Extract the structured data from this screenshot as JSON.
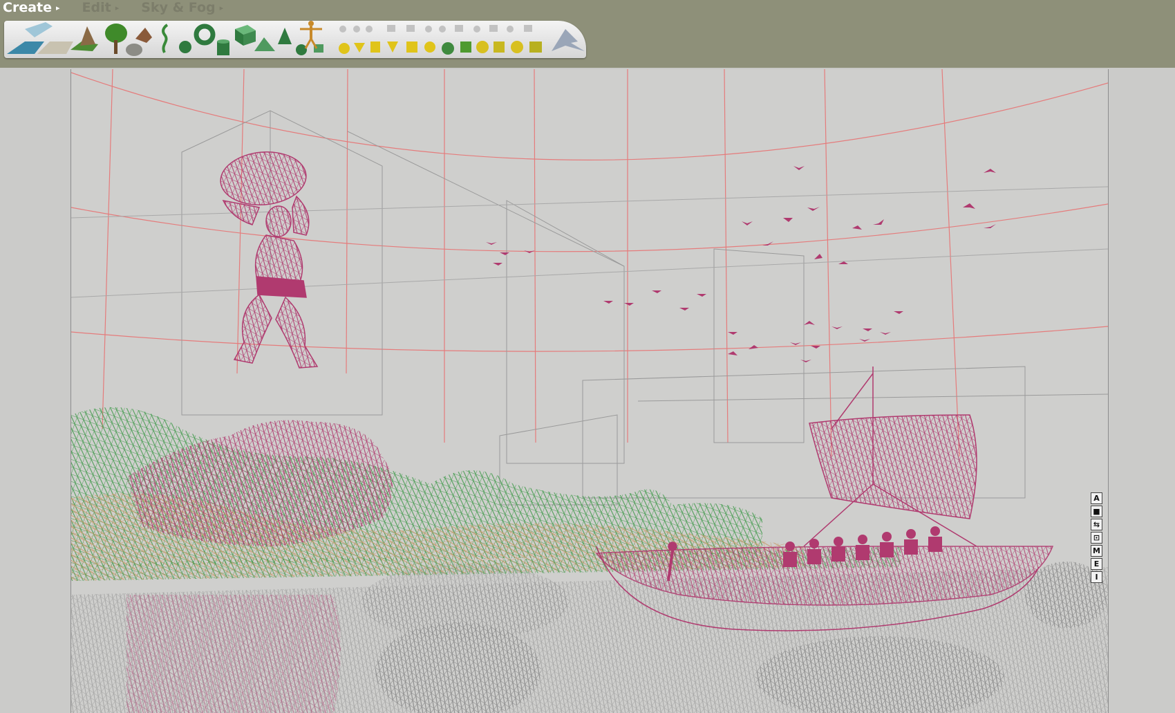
{
  "menu": {
    "create": "Create",
    "edit": "Edit",
    "sky_fog": "Sky & Fog"
  },
  "toolbar_icons": [
    "water-plane-icon",
    "ground-plane-icon",
    "terrain-icon",
    "tree-icon",
    "rock-icon",
    "plant-icon",
    "torus-icon",
    "cube-icon",
    "cone-icon",
    "sphere-icon",
    "cylinder-icon",
    "pyramid-icon",
    "human-figure-icon",
    "primitive-set-icon",
    "metablob-icon",
    "light-icon"
  ],
  "view_controls": [
    "A",
    "■",
    "⇆",
    "⊡",
    "M",
    "E",
    "I"
  ],
  "colors": {
    "topbar": "#8e9079",
    "selected_object": "#b03a6f",
    "terrain_wire": "#3f9a4a",
    "sand_wire": "#c89a6a",
    "sky_grid": "#e57b7b",
    "neutral_wire": "#8a8a8a"
  }
}
